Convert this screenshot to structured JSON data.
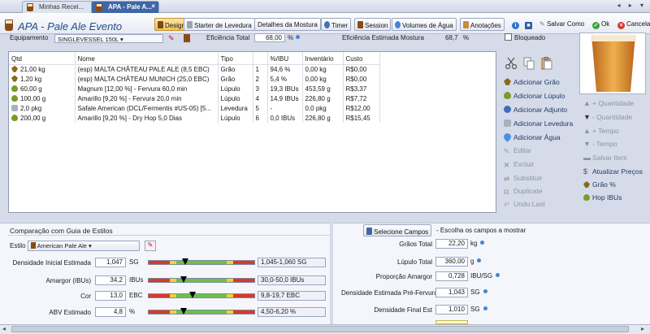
{
  "tabs": [
    {
      "label": "Minhas Recei..."
    },
    {
      "label": "APA - Pale A...",
      "close": "×"
    }
  ],
  "tab_nav": "◂ ▸ ▾",
  "recipe_title": "APA - Pale Ale Evento",
  "toolbar": {
    "design": "Design",
    "starter": "Starter de Levedura",
    "mash": "Detalhes da Mostura",
    "timer": "Timer",
    "session": "Session",
    "water": "Volumes de Água",
    "notes": "Anotações",
    "save_as": "Salvar Como",
    "ok": "Ok",
    "cancel": "Cancelar"
  },
  "properties": {
    "equipment_label": "Equipamento",
    "equipment_value": "SINGLEVESSEL 150L",
    "efficiency_label": "Eficiência Total",
    "efficiency_value": "68,00",
    "efficiency_unit": "%",
    "mash_eff_label": "Eficiência Estimada Mostura",
    "mash_eff_value": "68,7",
    "mash_eff_unit": "%",
    "locked_label": "Bloqueado"
  },
  "ingredients": {
    "columns": [
      "Qtd",
      "Nome",
      "Tipo",
      "",
      "%/IBU",
      "Inventário",
      "Custo"
    ],
    "rows": [
      {
        "icon": "grain",
        "qty": "21,00 kg",
        "name": "(esp) MALTA CHÂTEAU PALE ALE (8,5 EBC)",
        "type": "Grão",
        "num": "1",
        "pct": "94,6 %",
        "inv": "0,00 kg",
        "cost": "R$0,00"
      },
      {
        "icon": "grain",
        "qty": "1,20 kg",
        "name": "(esp) MALTA CHÂTEAU MUNICH (25,0 EBC)",
        "type": "Grão",
        "num": "2",
        "pct": "5,4 %",
        "inv": "0,00 kg",
        "cost": "R$0,00"
      },
      {
        "icon": "hop",
        "qty": "60,00 g",
        "name": "Magnum [12,00 %] - Fervura 60,0 min",
        "type": "Lúpulo",
        "num": "3",
        "pct": "19,3 IBUs",
        "inv": "453,59 g",
        "cost": "R$3,37"
      },
      {
        "icon": "hop",
        "qty": "100,00 g",
        "name": "Amarillo [9,20 %] - Fervura 20,0 min",
        "type": "Lúpulo",
        "num": "4",
        "pct": "14,9 IBUs",
        "inv": "226,80 g",
        "cost": "R$7,72"
      },
      {
        "icon": "yeast",
        "qty": "2,0 pkg",
        "name": "Safale American  (DCL/Fermentis #US-05) [5...",
        "type": "Levedura",
        "num": "5",
        "pct": "-",
        "inv": "0,0 pkg",
        "cost": "R$12,00"
      },
      {
        "icon": "hop",
        "qty": "200,00 g",
        "name": "Amarillo [9,20 %] - Dry Hop 5,0 Dias",
        "type": "Lúpulo",
        "num": "6",
        "pct": "0,0 IBUs",
        "inv": "226,80 g",
        "cost": "R$15,45"
      }
    ]
  },
  "actions": {
    "add_grain": "Adicionar Grão",
    "add_hop": "Adicionar Lúpulo",
    "add_adjunct": "Adicionar Adjunto",
    "add_yeast": "Adicionar Levedura",
    "add_water": "Adicionar Água",
    "edit": "Editar",
    "delete": "Excluir",
    "replace": "Substituir",
    "duplicate": "Duplicate",
    "undo": "Undo Last"
  },
  "side_actions": {
    "qty_up": "+ Quantidade",
    "qty_down": "- Quantidade",
    "time_up": "+ Tempo",
    "time_down": "- Tempo",
    "save_item": "Salvar Item",
    "update_prices": "Atualizar Preços",
    "grain_pct": "Grão %",
    "hop_ibus": "Hop IBUs"
  },
  "style_compare": {
    "title": "Comparação com Guia de Estilos",
    "style_label": "Estilo",
    "style_value": "American Pale Ale",
    "rows": [
      {
        "label": "Densidade Inicial Estimada",
        "value": "1,047",
        "unit": "SG",
        "range": "1,045-1,060 SG",
        "position": 0.35
      },
      {
        "label": "Amargor (IBUs)",
        "value": "34,2",
        "unit": "IBUs",
        "range": "30,0-50,0 IBUs",
        "position": 0.33
      },
      {
        "label": "Cor",
        "value": "13,0",
        "unit": "EBC",
        "range": "9,8-19,7 EBC",
        "position": 0.42
      },
      {
        "label": "ABV Estimado",
        "value": "4,8",
        "unit": "%",
        "range": "4,50-6,20 %",
        "position": 0.33
      }
    ]
  },
  "stats": {
    "select_button": "Selecione Campos",
    "select_hint": "- Escolha os campos a mostrar",
    "rows": [
      {
        "label": "Grãos Total",
        "value": "22,20",
        "unit": "kg"
      },
      {
        "label": "Lúpulo Total",
        "value": "360,00",
        "unit": "g"
      },
      {
        "label": "Proporção Amargor",
        "value": "0,728",
        "unit": "IBU/SG"
      },
      {
        "label": "Densidade Estimada Pré-Fervura",
        "value": "1,043",
        "unit": "SG"
      },
      {
        "label": "Densidade Final Est",
        "value": "1,010",
        "unit": "SG"
      }
    ]
  },
  "colors": {
    "accent": "#3f66a7",
    "beer": "#e39a3c",
    "gauge_red": "#d83a2a",
    "gauge_yellow": "#f0d235",
    "gauge_green": "#6cc04a"
  }
}
